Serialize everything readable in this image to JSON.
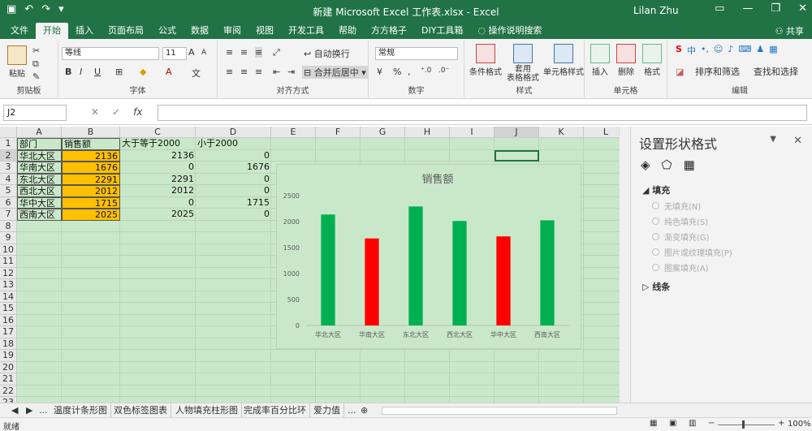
{
  "window": {
    "title": "新建 Microsoft Excel 工作表.xlsx  -  Excel",
    "user": "Lilan Zhu"
  },
  "tabs": [
    "文件",
    "开始",
    "插入",
    "页面布局",
    "公式",
    "数据",
    "审阅",
    "视图",
    "开发工具",
    "帮助",
    "方方格子",
    "DIY工具箱"
  ],
  "tell_me": "操作说明搜索",
  "share": "共享",
  "ribbon": {
    "clipboard": {
      "paste": "粘贴",
      "name": "剪贴板"
    },
    "font": {
      "family": "等线",
      "size": "11",
      "name": "字体"
    },
    "alignment": {
      "wrap": "自动换行",
      "merge": "合并后居中",
      "name": "对齐方式"
    },
    "number": {
      "format": "常规",
      "name": "数字"
    },
    "styles": {
      "conditional": "条件格式",
      "table": "套用\n表格格式",
      "cell": "单元格样式",
      "name": "样式"
    },
    "cells": {
      "insert": "插入",
      "delete": "删除",
      "format": "格式",
      "name": "单元格"
    },
    "editing": {
      "sort": "排序和筛选",
      "find": "查找和选择",
      "name": "编辑"
    }
  },
  "formula_bar": {
    "name_box": "J2",
    "fx": "fx",
    "value": ""
  },
  "columns": [
    "A",
    "B",
    "C",
    "D",
    "E",
    "F",
    "G",
    "H",
    "I",
    "J",
    "K",
    "L"
  ],
  "rows": [
    "1",
    "2",
    "3",
    "4",
    "5",
    "6",
    "7",
    "8",
    "9",
    "10",
    "11",
    "12",
    "13",
    "14",
    "15",
    "16",
    "17",
    "18",
    "19",
    "20",
    "21",
    "22",
    "23"
  ],
  "table": {
    "headers": [
      "部门",
      "销售额",
      "大于等于2000",
      "小于2000"
    ],
    "rows": [
      [
        "华北大区",
        "2136",
        "2136",
        "0"
      ],
      [
        "华南大区",
        "1676",
        "0",
        "1676"
      ],
      [
        "东北大区",
        "2291",
        "2291",
        "0"
      ],
      [
        "西北大区",
        "2012",
        "2012",
        "0"
      ],
      [
        "华中大区",
        "1715",
        "0",
        "1715"
      ],
      [
        "西南大区",
        "2025",
        "2025",
        "0"
      ]
    ]
  },
  "chart_data": {
    "type": "bar",
    "title": "销售额",
    "categories": [
      "华北大区",
      "华南大区",
      "东北大区",
      "西北大区",
      "华中大区",
      "西南大区"
    ],
    "series": [
      {
        "values": [
          2136,
          0,
          2291,
          2012,
          0,
          2025
        ],
        "color": "#00b050"
      },
      {
        "values": [
          0,
          1676,
          0,
          0,
          1715,
          0
        ],
        "color": "#ff0000"
      }
    ],
    "ylim": [
      0,
      2500
    ],
    "yticks": [
      "0",
      "500",
      "1000",
      "1500",
      "2000",
      "2500"
    ],
    "grid": false,
    "xlabel": "",
    "ylabel": ""
  },
  "pane": {
    "title": "设置形状格式",
    "fill_section": "填充",
    "options": [
      "无填充(N)",
      "纯色填充(S)",
      "渐变填充(G)",
      "图片或纹理填充(P)",
      "图案填充(A)"
    ],
    "line_section": "线条"
  },
  "sheet_tabs": [
    "温度计条形图",
    "双色标签图表",
    "人物填充柱形图",
    "完成率百分比环",
    "爱力值"
  ],
  "status": {
    "ready": "就绪",
    "zoom": "100%"
  },
  "colors": {
    "excel_green": "#217346",
    "orange": "#ffc000",
    "sheet_bg": "#c9e8c9"
  }
}
